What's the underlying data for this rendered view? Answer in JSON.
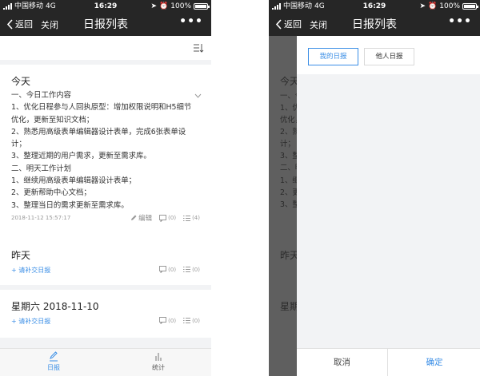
{
  "status_bar": {
    "carrier": "中国移动",
    "network": "4G",
    "time": "16:29",
    "battery": "100%"
  },
  "nav": {
    "back_label": "返回",
    "close_label": "关闭",
    "title": "日报列表",
    "more_label": "•••"
  },
  "reports": [
    {
      "day": "今天",
      "lines": [
        "一、今日工作内容",
        "1、优化日程参与人回执原型：增加权限说明和H5细节",
        "优化，更新至知识文档；",
        "2、熟悉用高级表单编辑器设计表单，完成6张表单设",
        "计；",
        "3、整理近期的用户需求，更新至需求库。",
        "二、明天工作计划",
        "1、继续用高级表单编辑器设计表单；",
        "2、更新帮助中心文档；",
        "3、整理当日的需求更新至需求库。"
      ],
      "timestamp": "2018-11-12 15:57:17",
      "edit_label": "编辑",
      "comment_count": "(0)",
      "read_count": "(4)"
    },
    {
      "day": "昨天",
      "supplement_label": "+ 请补交日报",
      "comment_count": "(0)",
      "read_count": "(0)"
    },
    {
      "day": "星期六 2018-11-10",
      "supplement_label": "+ 请补交日报",
      "comment_count": "(0)",
      "read_count": "(0)"
    }
  ],
  "tabbar": {
    "daily_label": "日报",
    "stats_label": "统计"
  },
  "filter_panel": {
    "my_reports_label": "我的日报",
    "others_reports_label": "他人日报",
    "cancel_label": "取消",
    "confirm_label": "确定"
  },
  "colors": {
    "accent": "#3a8ee6",
    "header": "#262626",
    "overlay": "#5f5f5f"
  },
  "icons": [
    "back-chevron-icon",
    "more-icon",
    "filter-icon",
    "chevron-down-icon",
    "edit-icon",
    "comment-icon",
    "read-list-icon",
    "pen-icon",
    "stats-icon"
  ]
}
